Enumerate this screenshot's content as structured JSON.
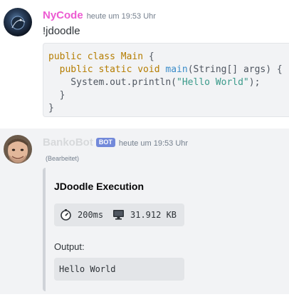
{
  "messages": [
    {
      "username": "NyCode",
      "timestamp": "heute um 19:53 Uhr",
      "text": "!jdoodle",
      "username_color": "#ec5bd2",
      "code_lines": [
        [
          {
            "t": "public class ",
            "c": "kw"
          },
          {
            "t": "Main",
            "c": "kw"
          },
          {
            "t": " {",
            "c": ""
          }
        ],
        [
          {
            "t": "  public static void ",
            "c": "kw"
          },
          {
            "t": "main",
            "c": "fn"
          },
          {
            "t": "(String[] args) {",
            "c": ""
          }
        ],
        [
          {
            "t": "    System.out.println(",
            "c": ""
          },
          {
            "t": "\"Hello World\"",
            "c": "str"
          },
          {
            "t": ");",
            "c": ""
          }
        ],
        [
          {
            "t": "  }",
            "c": ""
          }
        ],
        [
          {
            "t": "}",
            "c": ""
          }
        ]
      ]
    },
    {
      "username": "BankoBot",
      "bot_tag": "BOT",
      "timestamp": "heute um 19:53 Uhr",
      "edited": "(Bearbeitet)",
      "username_color": "#d7d9db",
      "embed": {
        "title": "JDoodle Execution",
        "cpu_time": "200ms",
        "memory": "31.912 KB",
        "output_label": "Output:",
        "output": "Hello World",
        "border_color": "#d0d3d8"
      }
    }
  ],
  "icons": [
    "avatar-nycode",
    "avatar-bankobot",
    "stopwatch-icon",
    "monitor-icon"
  ]
}
